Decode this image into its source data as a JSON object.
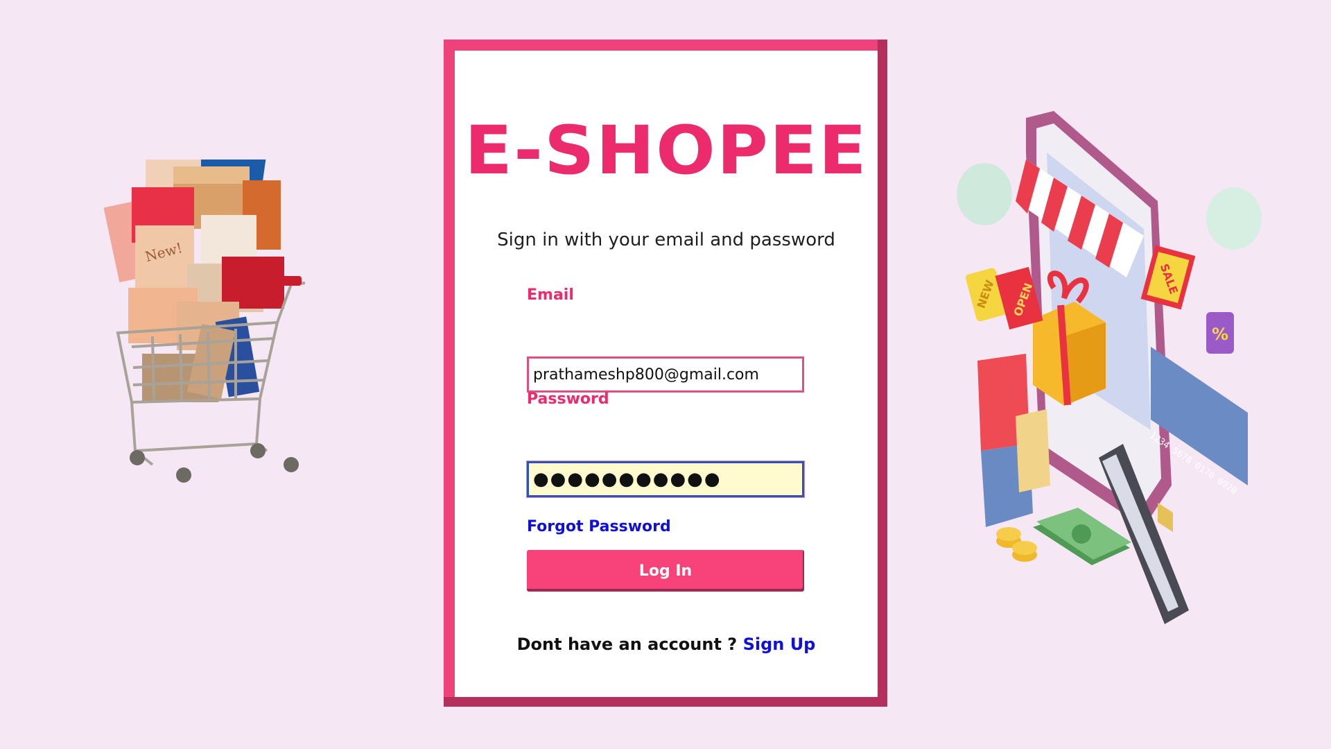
{
  "brand": {
    "name": "E-SHOPEE"
  },
  "login": {
    "subtitle": "Sign in with your email and password",
    "email_label": "Email",
    "email_value": "prathameshp800@gmail.com",
    "password_label": "Password",
    "password_value": "●●●●●●●●●●●",
    "forgot_label": "Forgot Password",
    "login_button": "Log In",
    "signup_prompt": "Dont have an account ? ",
    "signup_link": "Sign Up"
  },
  "illustrations": {
    "cart_tag": "New!",
    "phone_tags": {
      "new": "NEW",
      "open": "OPEN",
      "sale": "SALE",
      "percent": "%"
    },
    "card_number": "1234 5678 0170 0920"
  },
  "colors": {
    "page_bg": "#f6e7f5",
    "brand": "#ec2b6d",
    "frame": "#f0427a",
    "frame_shadow": "#b52f5d",
    "button": "#f8437a",
    "link": "#1010d8",
    "password_bg": "#fffbcf"
  }
}
